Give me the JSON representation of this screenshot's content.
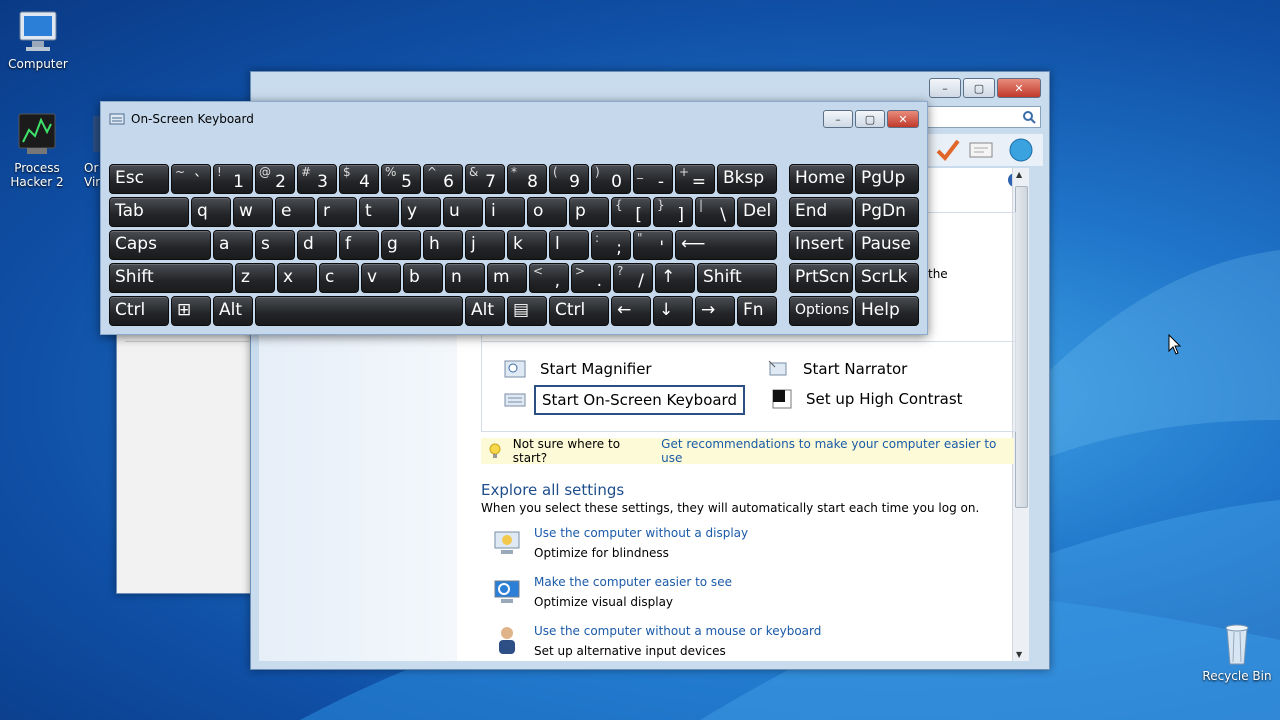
{
  "desktop": {
    "icons": [
      {
        "label": "Computer"
      },
      {
        "label": "Process Hacker 2"
      },
      {
        "label": "Or\nVir"
      },
      {
        "label": "Recycle Bin"
      }
    ]
  },
  "osk": {
    "title": "On-Screen Keyboard",
    "rows": [
      [
        {
          "main": "Esc",
          "w": 58
        },
        {
          "sup": "~",
          "sub": "`",
          "w": 38
        },
        {
          "sup": "!",
          "sub": "1",
          "w": 38
        },
        {
          "sup": "@",
          "sub": "2",
          "w": 38
        },
        {
          "sup": "#",
          "sub": "3",
          "w": 38
        },
        {
          "sup": "$",
          "sub": "4",
          "w": 38
        },
        {
          "sup": "%",
          "sub": "5",
          "w": 38
        },
        {
          "sup": "^",
          "sub": "6",
          "w": 38
        },
        {
          "sup": "&",
          "sub": "7",
          "w": 38
        },
        {
          "sup": "*",
          "sub": "8",
          "w": 38
        },
        {
          "sup": "(",
          "sub": "9",
          "w": 38
        },
        {
          "sup": ")",
          "sub": "0",
          "w": 38
        },
        {
          "sup": "_",
          "sub": "-",
          "w": 38
        },
        {
          "sup": "+",
          "sub": "=",
          "w": 38
        },
        {
          "main": "Bksp",
          "w": 58,
          "gap": 0
        },
        {
          "main": "Home",
          "w": 62,
          "gap": 10
        },
        {
          "main": "PgUp",
          "w": 62
        }
      ],
      [
        {
          "main": "Tab",
          "w": 78
        },
        {
          "main": "q",
          "w": 38
        },
        {
          "main": "w",
          "w": 38
        },
        {
          "main": "e",
          "w": 38
        },
        {
          "main": "r",
          "w": 38
        },
        {
          "main": "t",
          "w": 38
        },
        {
          "main": "y",
          "w": 38
        },
        {
          "main": "u",
          "w": 38
        },
        {
          "main": "i",
          "w": 38
        },
        {
          "main": "o",
          "w": 38
        },
        {
          "main": "p",
          "w": 38
        },
        {
          "sup": "{",
          "sub": "[",
          "w": 38
        },
        {
          "sup": "}",
          "sub": "]",
          "w": 38
        },
        {
          "sup": "|",
          "sub": "\\",
          "w": 38
        },
        {
          "main": "Del",
          "w": 38
        },
        {
          "main": "End",
          "w": 62,
          "gap": 10
        },
        {
          "main": "PgDn",
          "w": 62
        }
      ],
      [
        {
          "main": "Caps",
          "w": 100
        },
        {
          "main": "a",
          "w": 38
        },
        {
          "main": "s",
          "w": 38
        },
        {
          "main": "d",
          "w": 38
        },
        {
          "main": "f",
          "w": 38
        },
        {
          "main": "g",
          "w": 38
        },
        {
          "main": "h",
          "w": 38
        },
        {
          "main": "j",
          "w": 38
        },
        {
          "main": "k",
          "w": 38
        },
        {
          "main": "l",
          "w": 38
        },
        {
          "sup": ":",
          "sub": ";",
          "w": 38
        },
        {
          "sup": "\"",
          "sub": "'",
          "w": 38
        },
        {
          "main": "⟵",
          "w": 100
        },
        {
          "main": "Insert",
          "w": 62,
          "gap": 10
        },
        {
          "main": "Pause",
          "w": 62
        }
      ],
      [
        {
          "main": "Shift",
          "w": 122
        },
        {
          "main": "z",
          "w": 38
        },
        {
          "main": "x",
          "w": 38
        },
        {
          "main": "c",
          "w": 38
        },
        {
          "main": "v",
          "w": 38
        },
        {
          "main": "b",
          "w": 38
        },
        {
          "main": "n",
          "w": 38
        },
        {
          "main": "m",
          "w": 38
        },
        {
          "sup": "<",
          "sub": ",",
          "w": 38
        },
        {
          "sup": ">",
          "sub": ".",
          "w": 38
        },
        {
          "sup": "?",
          "sub": "/",
          "w": 38
        },
        {
          "main": "↑",
          "w": 38
        },
        {
          "main": "Shift",
          "w": 78
        },
        {
          "main": "PrtScn",
          "w": 62,
          "gap": 10
        },
        {
          "main": "ScrLk",
          "w": 62
        }
      ],
      [
        {
          "main": "Ctrl",
          "w": 58
        },
        {
          "main": "⊞",
          "w": 38
        },
        {
          "main": "Alt",
          "w": 38
        },
        {
          "main": "",
          "w": 206
        },
        {
          "main": "Alt",
          "w": 38
        },
        {
          "main": "▤",
          "w": 38
        },
        {
          "main": "Ctrl",
          "w": 58
        },
        {
          "main": "←",
          "w": 38
        },
        {
          "main": "↓",
          "w": 38
        },
        {
          "main": "→",
          "w": 38
        },
        {
          "main": "Fn",
          "w": 38
        },
        {
          "main": "Options",
          "w": 62,
          "gap": 10,
          "small": true
        },
        {
          "main": "Help",
          "w": 62
        }
      ]
    ]
  },
  "ease": {
    "quick_tools": [
      {
        "label": "Start Magnifier"
      },
      {
        "label": "Start Narrator"
      },
      {
        "label": "Start On-Screen Keyboard"
      },
      {
        "label": "Set up High Contrast"
      }
    ],
    "partial_text": "the",
    "tip_text": "Not sure where to start?",
    "tip_link": "Get recommendations to make your computer easier to use",
    "explore_heading": "Explore all settings",
    "explore_desc": "When you select these settings, they will automatically start each time you log on.",
    "settings": [
      {
        "link": "Use the computer without a display",
        "desc": "Optimize for blindness"
      },
      {
        "link": "Make the computer easier to see",
        "desc": "Optimize visual display"
      },
      {
        "link": "Use the computer without a mouse or keyboard",
        "desc": "Set up alternative input devices"
      }
    ]
  }
}
